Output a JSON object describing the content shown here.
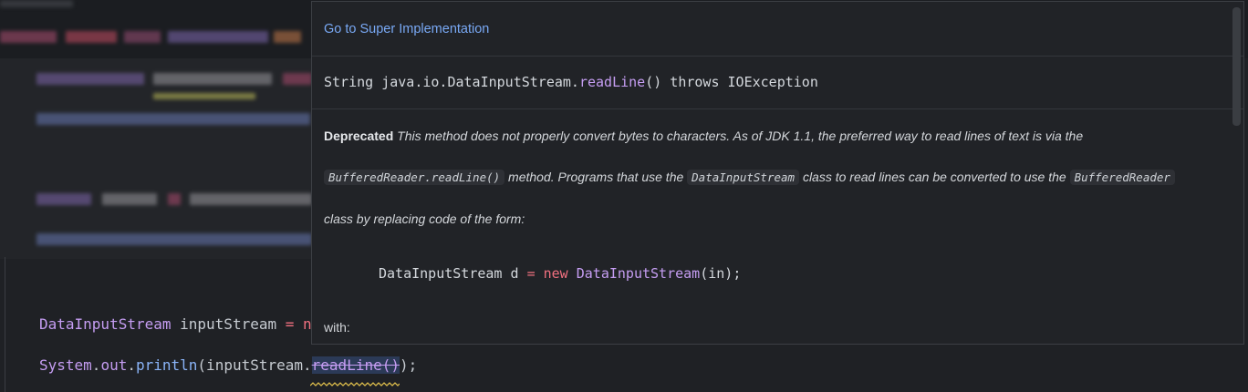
{
  "editor": {
    "line1": {
      "type": "DataInputStream",
      "var": "inputStream",
      "op": "=",
      "trail": "n"
    },
    "line2": {
      "obj": "System",
      "field": "out",
      "call": "println",
      "arg_open": "(inputStream.",
      "method": "readLine",
      "parens": "()",
      "close": ");"
    }
  },
  "popup": {
    "goto_link": "Go to Super Implementation",
    "signature": {
      "prefix": "String java.io.DataInputStream.",
      "method": "readLine",
      "suffix": "() throws IOException"
    },
    "doc": {
      "deprecated_label": "Deprecated",
      "line1": "This method does not properly convert bytes to characters. As of JDK 1.1, the preferred way to read lines of text is via the",
      "chip1": "BufferedReader.readLine()",
      "line2_a": "method. Programs that use the",
      "chip2": "DataInputStream",
      "line2_b": "class to read lines can be converted to use the",
      "chip3": "BufferedReader",
      "line3": "class by replacing code of the form:",
      "example": {
        "type": "DataInputStream",
        "var": "d",
        "op": "=",
        "kw": "new",
        "ctor": "DataInputStream",
        "args": "(in);"
      },
      "with_label": "with:"
    }
  },
  "colors": {
    "background": "#1f2125",
    "popup_bg": "#212327",
    "link": "#79a9f5",
    "type": "#c59df2",
    "keyword": "#f0707f",
    "squiggle": "#d6b84a"
  }
}
